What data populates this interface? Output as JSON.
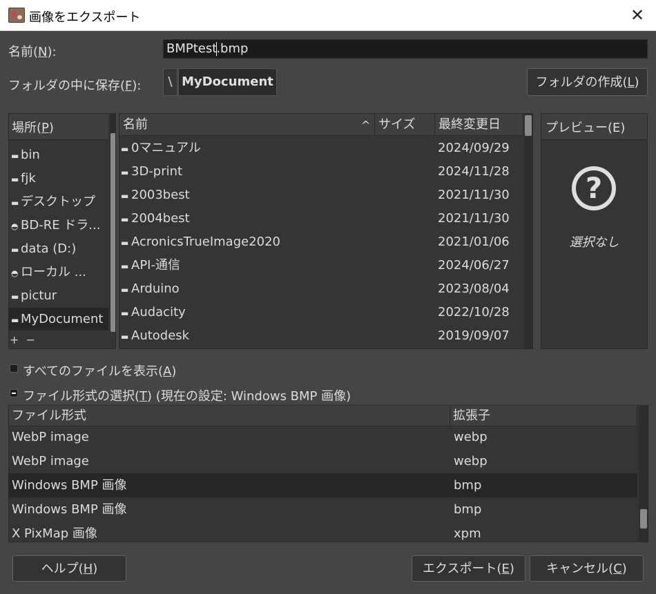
{
  "window": {
    "title": "画像をエクスポート",
    "close_glyph": "✕"
  },
  "name_row": {
    "label_prefix": "名前(",
    "label_key": "N",
    "label_suffix": "):",
    "value_before_caret": "BMPtest",
    "value_after_caret": ".bmp"
  },
  "folder_row": {
    "label_prefix": "フォルダの中に保存(",
    "label_key": "F",
    "label_suffix": "):",
    "separator": "\\",
    "current_folder": "MyDocument",
    "create_folder_prefix": "フォルダの作成(",
    "create_folder_key": "L",
    "create_folder_suffix": ")"
  },
  "places": {
    "header_prefix": "場所(",
    "header_key": "P",
    "header_suffix": ")",
    "items": [
      {
        "icon": "folder-icon",
        "glyph": "▬",
        "label": "bin"
      },
      {
        "icon": "folder-icon",
        "glyph": "▬",
        "label": "fjk"
      },
      {
        "icon": "folder-icon",
        "glyph": "▬",
        "label": "デスクトップ"
      },
      {
        "icon": "optical-drive-icon",
        "glyph": "◓",
        "label": "BD-RE ドラ..."
      },
      {
        "icon": "drive-icon",
        "glyph": "▬",
        "label": "data (D:)"
      },
      {
        "icon": "network-drive-icon",
        "glyph": "◓",
        "label": "ローカル ..."
      },
      {
        "icon": "folder-icon",
        "glyph": "▬",
        "label": "pictur"
      },
      {
        "icon": "folder-icon",
        "glyph": "▬",
        "label": "MyDocument"
      }
    ],
    "add": "+",
    "remove": "−"
  },
  "files": {
    "columns": {
      "name": "名前",
      "size": "サイズ",
      "modified": "最終変更日"
    },
    "sort_glyph": "^",
    "rows": [
      {
        "name": "0マニュアル",
        "modified": "2024/09/29"
      },
      {
        "name": "3D-print",
        "modified": "2024/11/28"
      },
      {
        "name": "2003best",
        "modified": "2021/11/30"
      },
      {
        "name": "2004best",
        "modified": "2021/11/30"
      },
      {
        "name": "AcronicsTrueImage2020",
        "modified": "2021/01/06"
      },
      {
        "name": "API-通信",
        "modified": "2024/06/27"
      },
      {
        "name": "Arduino",
        "modified": "2023/08/04"
      },
      {
        "name": "Audacity",
        "modified": "2022/10/28"
      },
      {
        "name": "Autodesk",
        "modified": "2019/09/07"
      }
    ]
  },
  "preview": {
    "header": "プレビュー(E)",
    "glyph": "?",
    "empty_text": "選択なし"
  },
  "options": {
    "show_all_prefix": "すべてのファイルを表示(",
    "show_all_key": "A",
    "show_all_suffix": ")",
    "select_type_prefix": "ファイル形式の選択(",
    "select_type_key": "T",
    "select_type_suffix": ")",
    "current_setting": "(現在の設定: Windows BMP 画像)"
  },
  "file_types": {
    "columns": {
      "type": "ファイル形式",
      "ext": "拡張子"
    },
    "rows": [
      {
        "type": "WebP image",
        "ext": "webp",
        "selected": false
      },
      {
        "type": "WebP image",
        "ext": "webp",
        "selected": false
      },
      {
        "type": "Windows BMP 画像",
        "ext": "bmp",
        "selected": true
      },
      {
        "type": "Windows BMP 画像",
        "ext": "bmp",
        "selected": false
      },
      {
        "type": "X PixMap 画像",
        "ext": "xpm",
        "selected": false
      }
    ]
  },
  "buttons": {
    "help_prefix": "ヘルプ(",
    "help_key": "H",
    "help_suffix": ")",
    "export_prefix": "エクスポート(",
    "export_key": "E",
    "export_suffix": ")",
    "cancel_prefix": "キャンセル(",
    "cancel_key": "C",
    "cancel_suffix": ")"
  },
  "colors": {
    "dialog_bg": "#454545",
    "panel_bg": "#353535",
    "selected_row": "#262626",
    "input_bg": "#1b1b1b"
  }
}
